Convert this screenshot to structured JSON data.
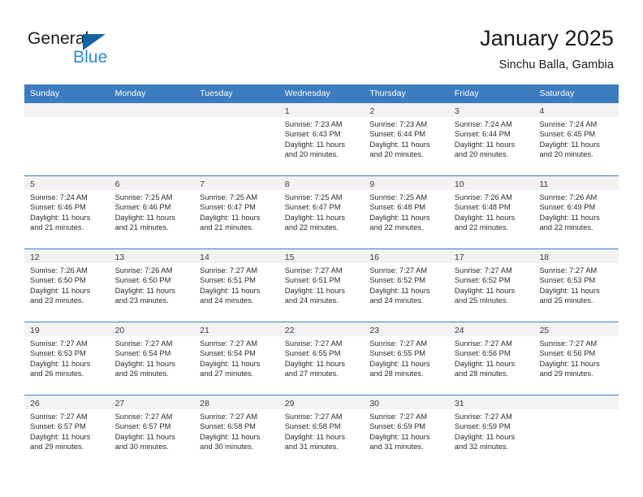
{
  "brand": {
    "name_part1": "General",
    "name_part2": "Blue",
    "triangle_color": "#1464a5",
    "blue_text_color": "#2b8ad4"
  },
  "header": {
    "title": "January 2025",
    "subtitle": "Sinchu Balla, Gambia"
  },
  "theme": {
    "header_row_bg": "#3c7dc0",
    "day_band_bg": "#f2f2f2",
    "row_divider": "#3c7dc0",
    "text": "#2b2b2b"
  },
  "weekdays": [
    "Sunday",
    "Monday",
    "Tuesday",
    "Wednesday",
    "Thursday",
    "Friday",
    "Saturday"
  ],
  "weeks": [
    {
      "days": [
        {
          "date": "",
          "sunrise": "",
          "sunset": "",
          "daylight_line1": "",
          "daylight_line2": "",
          "empty": true
        },
        {
          "date": "",
          "sunrise": "",
          "sunset": "",
          "daylight_line1": "",
          "daylight_line2": "",
          "empty": true
        },
        {
          "date": "",
          "sunrise": "",
          "sunset": "",
          "daylight_line1": "",
          "daylight_line2": "",
          "empty": true
        },
        {
          "date": "1",
          "sunrise": "Sunrise: 7:23 AM",
          "sunset": "Sunset: 6:43 PM",
          "daylight_line1": "Daylight: 11 hours",
          "daylight_line2": "and 20 minutes.",
          "empty": false
        },
        {
          "date": "2",
          "sunrise": "Sunrise: 7:23 AM",
          "sunset": "Sunset: 6:44 PM",
          "daylight_line1": "Daylight: 11 hours",
          "daylight_line2": "and 20 minutes.",
          "empty": false
        },
        {
          "date": "3",
          "sunrise": "Sunrise: 7:24 AM",
          "sunset": "Sunset: 6:44 PM",
          "daylight_line1": "Daylight: 11 hours",
          "daylight_line2": "and 20 minutes.",
          "empty": false
        },
        {
          "date": "4",
          "sunrise": "Sunrise: 7:24 AM",
          "sunset": "Sunset: 6:45 PM",
          "daylight_line1": "Daylight: 11 hours",
          "daylight_line2": "and 20 minutes.",
          "empty": false
        }
      ]
    },
    {
      "days": [
        {
          "date": "5",
          "sunrise": "Sunrise: 7:24 AM",
          "sunset": "Sunset: 6:46 PM",
          "daylight_line1": "Daylight: 11 hours",
          "daylight_line2": "and 21 minutes.",
          "empty": false
        },
        {
          "date": "6",
          "sunrise": "Sunrise: 7:25 AM",
          "sunset": "Sunset: 6:46 PM",
          "daylight_line1": "Daylight: 11 hours",
          "daylight_line2": "and 21 minutes.",
          "empty": false
        },
        {
          "date": "7",
          "sunrise": "Sunrise: 7:25 AM",
          "sunset": "Sunset: 6:47 PM",
          "daylight_line1": "Daylight: 11 hours",
          "daylight_line2": "and 21 minutes.",
          "empty": false
        },
        {
          "date": "8",
          "sunrise": "Sunrise: 7:25 AM",
          "sunset": "Sunset: 6:47 PM",
          "daylight_line1": "Daylight: 11 hours",
          "daylight_line2": "and 22 minutes.",
          "empty": false
        },
        {
          "date": "9",
          "sunrise": "Sunrise: 7:25 AM",
          "sunset": "Sunset: 6:48 PM",
          "daylight_line1": "Daylight: 11 hours",
          "daylight_line2": "and 22 minutes.",
          "empty": false
        },
        {
          "date": "10",
          "sunrise": "Sunrise: 7:26 AM",
          "sunset": "Sunset: 6:48 PM",
          "daylight_line1": "Daylight: 11 hours",
          "daylight_line2": "and 22 minutes.",
          "empty": false
        },
        {
          "date": "11",
          "sunrise": "Sunrise: 7:26 AM",
          "sunset": "Sunset: 6:49 PM",
          "daylight_line1": "Daylight: 11 hours",
          "daylight_line2": "and 22 minutes.",
          "empty": false
        }
      ]
    },
    {
      "days": [
        {
          "date": "12",
          "sunrise": "Sunrise: 7:26 AM",
          "sunset": "Sunset: 6:50 PM",
          "daylight_line1": "Daylight: 11 hours",
          "daylight_line2": "and 23 minutes.",
          "empty": false
        },
        {
          "date": "13",
          "sunrise": "Sunrise: 7:26 AM",
          "sunset": "Sunset: 6:50 PM",
          "daylight_line1": "Daylight: 11 hours",
          "daylight_line2": "and 23 minutes.",
          "empty": false
        },
        {
          "date": "14",
          "sunrise": "Sunrise: 7:27 AM",
          "sunset": "Sunset: 6:51 PM",
          "daylight_line1": "Daylight: 11 hours",
          "daylight_line2": "and 24 minutes.",
          "empty": false
        },
        {
          "date": "15",
          "sunrise": "Sunrise: 7:27 AM",
          "sunset": "Sunset: 6:51 PM",
          "daylight_line1": "Daylight: 11 hours",
          "daylight_line2": "and 24 minutes.",
          "empty": false
        },
        {
          "date": "16",
          "sunrise": "Sunrise: 7:27 AM",
          "sunset": "Sunset: 6:52 PM",
          "daylight_line1": "Daylight: 11 hours",
          "daylight_line2": "and 24 minutes.",
          "empty": false
        },
        {
          "date": "17",
          "sunrise": "Sunrise: 7:27 AM",
          "sunset": "Sunset: 6:52 PM",
          "daylight_line1": "Daylight: 11 hours",
          "daylight_line2": "and 25 minutes.",
          "empty": false
        },
        {
          "date": "18",
          "sunrise": "Sunrise: 7:27 AM",
          "sunset": "Sunset: 6:53 PM",
          "daylight_line1": "Daylight: 11 hours",
          "daylight_line2": "and 25 minutes.",
          "empty": false
        }
      ]
    },
    {
      "days": [
        {
          "date": "19",
          "sunrise": "Sunrise: 7:27 AM",
          "sunset": "Sunset: 6:53 PM",
          "daylight_line1": "Daylight: 11 hours",
          "daylight_line2": "and 26 minutes.",
          "empty": false
        },
        {
          "date": "20",
          "sunrise": "Sunrise: 7:27 AM",
          "sunset": "Sunset: 6:54 PM",
          "daylight_line1": "Daylight: 11 hours",
          "daylight_line2": "and 26 minutes.",
          "empty": false
        },
        {
          "date": "21",
          "sunrise": "Sunrise: 7:27 AM",
          "sunset": "Sunset: 6:54 PM",
          "daylight_line1": "Daylight: 11 hours",
          "daylight_line2": "and 27 minutes.",
          "empty": false
        },
        {
          "date": "22",
          "sunrise": "Sunrise: 7:27 AM",
          "sunset": "Sunset: 6:55 PM",
          "daylight_line1": "Daylight: 11 hours",
          "daylight_line2": "and 27 minutes.",
          "empty": false
        },
        {
          "date": "23",
          "sunrise": "Sunrise: 7:27 AM",
          "sunset": "Sunset: 6:55 PM",
          "daylight_line1": "Daylight: 11 hours",
          "daylight_line2": "and 28 minutes.",
          "empty": false
        },
        {
          "date": "24",
          "sunrise": "Sunrise: 7:27 AM",
          "sunset": "Sunset: 6:56 PM",
          "daylight_line1": "Daylight: 11 hours",
          "daylight_line2": "and 28 minutes.",
          "empty": false
        },
        {
          "date": "25",
          "sunrise": "Sunrise: 7:27 AM",
          "sunset": "Sunset: 6:56 PM",
          "daylight_line1": "Daylight: 11 hours",
          "daylight_line2": "and 29 minutes.",
          "empty": false
        }
      ]
    },
    {
      "days": [
        {
          "date": "26",
          "sunrise": "Sunrise: 7:27 AM",
          "sunset": "Sunset: 6:57 PM",
          "daylight_line1": "Daylight: 11 hours",
          "daylight_line2": "and 29 minutes.",
          "empty": false
        },
        {
          "date": "27",
          "sunrise": "Sunrise: 7:27 AM",
          "sunset": "Sunset: 6:57 PM",
          "daylight_line1": "Daylight: 11 hours",
          "daylight_line2": "and 30 minutes.",
          "empty": false
        },
        {
          "date": "28",
          "sunrise": "Sunrise: 7:27 AM",
          "sunset": "Sunset: 6:58 PM",
          "daylight_line1": "Daylight: 11 hours",
          "daylight_line2": "and 30 minutes.",
          "empty": false
        },
        {
          "date": "29",
          "sunrise": "Sunrise: 7:27 AM",
          "sunset": "Sunset: 6:58 PM",
          "daylight_line1": "Daylight: 11 hours",
          "daylight_line2": "and 31 minutes.",
          "empty": false
        },
        {
          "date": "30",
          "sunrise": "Sunrise: 7:27 AM",
          "sunset": "Sunset: 6:59 PM",
          "daylight_line1": "Daylight: 11 hours",
          "daylight_line2": "and 31 minutes.",
          "empty": false
        },
        {
          "date": "31",
          "sunrise": "Sunrise: 7:27 AM",
          "sunset": "Sunset: 6:59 PM",
          "daylight_line1": "Daylight: 11 hours",
          "daylight_line2": "and 32 minutes.",
          "empty": false
        },
        {
          "date": "",
          "sunrise": "",
          "sunset": "",
          "daylight_line1": "",
          "daylight_line2": "",
          "empty": true
        }
      ]
    }
  ]
}
